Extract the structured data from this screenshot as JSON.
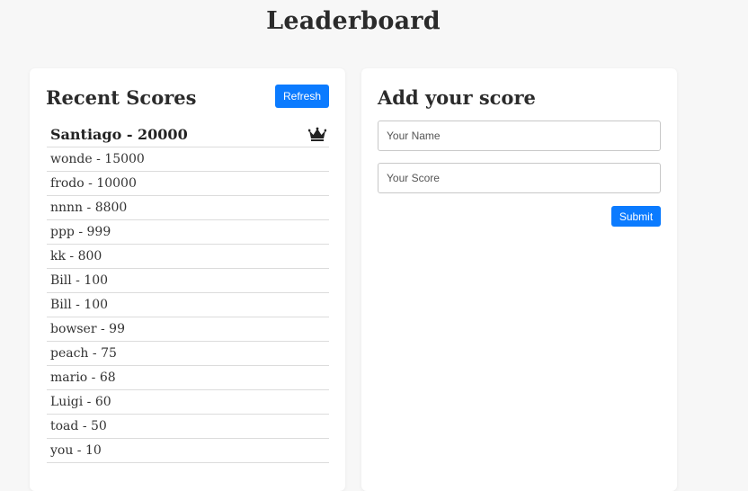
{
  "page": {
    "title": "Leaderboard"
  },
  "recent": {
    "title": "Recent Scores",
    "refresh_label": "Refresh",
    "top_entry": "Santiago - 20000",
    "top_icon": "crown-icon",
    "entries": [
      "wonde - 15000",
      "frodo - 10000",
      "nnnn - 8800",
      "ppp - 999",
      "kk - 800",
      "Bill - 100",
      "Bill - 100",
      "bowser - 99",
      "peach - 75",
      "mario - 68",
      "Luigi - 60",
      "toad - 50",
      "you - 10"
    ]
  },
  "add": {
    "title": "Add your score",
    "name_placeholder": "Your Name",
    "name_value": "",
    "score_placeholder": "Your Score",
    "score_value": "",
    "submit_label": "Submit"
  },
  "colors": {
    "accent": "#0b7bff",
    "background": "#f7f7f7",
    "card": "#ffffff"
  }
}
